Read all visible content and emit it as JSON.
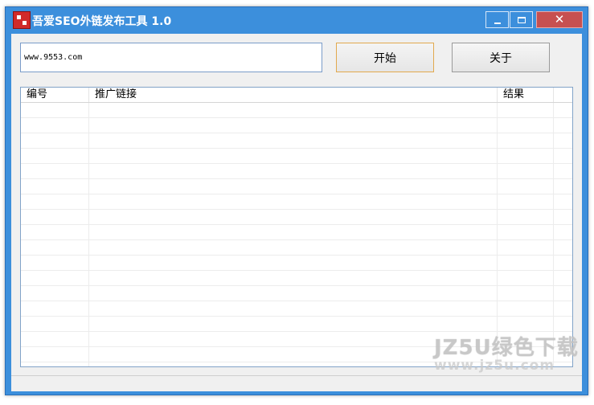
{
  "window": {
    "title": "吾爱SEO外链发布工具 1.0",
    "icon": "app-logo-icon",
    "controls": {
      "minimize": "minimize-icon",
      "maximize": "maximize-icon",
      "close_glyph": "✕"
    }
  },
  "toolbar": {
    "url_value": "www.9553.com",
    "url_placeholder": "",
    "start_label": "开始",
    "about_label": "关于"
  },
  "table": {
    "columns": [
      "编号",
      "推广链接",
      "结果"
    ],
    "rows": []
  },
  "status": {
    "text": ""
  },
  "watermark": {
    "line1": "JZ5U绿色下载",
    "line2": "www.jz5u.com"
  },
  "colors": {
    "titlebar": "#3c8fdc",
    "close_button": "#c75050",
    "start_border": "#e2a94e"
  }
}
